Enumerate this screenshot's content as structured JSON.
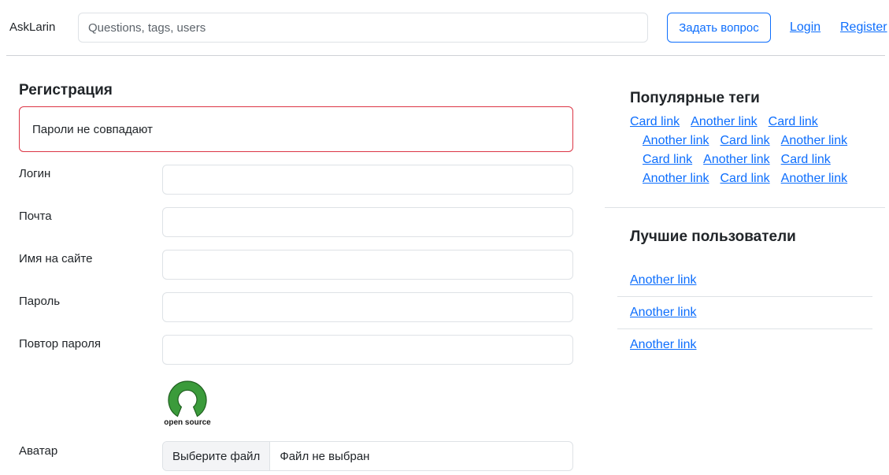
{
  "header": {
    "brand": "AskLarin",
    "search_placeholder": "Questions, tags, users",
    "ask_button": "Задать вопрос",
    "login": "Login",
    "register": "Register"
  },
  "form": {
    "title": "Регистрация",
    "alert": "Пароли не совпадают",
    "fields": {
      "login": "Логин",
      "email": "Почта",
      "nickname": "Имя на сайте",
      "password": "Пароль",
      "password_repeat": "Повтор пароля",
      "avatar": "Аватар"
    },
    "logo_text": "open source",
    "file_button": "Выберите файл",
    "file_status": "Файл не выбран"
  },
  "sidebar": {
    "tags_title": "Популярные теги",
    "tag_rows": [
      [
        "Card link",
        "Another link",
        "Card link"
      ],
      [
        "Another link",
        "Card link",
        "Another link"
      ],
      [
        "Card link",
        "Another link",
        "Card link"
      ],
      [
        "Another link",
        "Card link",
        "Another link"
      ]
    ],
    "users_title": "Лучшие пользователи",
    "users": [
      "Another link",
      "Another link",
      "Another link"
    ]
  },
  "colors": {
    "primary": "#0d6efd",
    "danger": "#dc3545",
    "logo_green": "#3b9b3b"
  }
}
